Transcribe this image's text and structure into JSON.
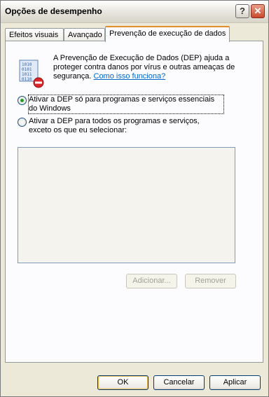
{
  "window": {
    "title": "Opções de desempenho",
    "help_glyph": "?",
    "close_glyph": "✕"
  },
  "tabs": [
    {
      "label": "Efeitos visuais"
    },
    {
      "label": "Avançado"
    },
    {
      "label": "Prevenção de execução de dados",
      "active": true
    }
  ],
  "dep": {
    "description": "A Prevenção de Execução de Dados (DEP) ajuda a proteger contra danos por vírus e outras ameaças de segurança.",
    "link": "Como isso funciona?"
  },
  "options": [
    {
      "label": "Ativar a DEP só para programas e serviços essenciais do Windows",
      "checked": true
    },
    {
      "label": "Ativar a DEP para todos os programas e serviços, exceto os que eu selecionar:",
      "checked": false
    }
  ],
  "list_buttons": {
    "add": "Adicionar...",
    "remove": "Remover"
  },
  "dialog_buttons": {
    "ok": "OK",
    "cancel": "Cancelar",
    "apply": "Aplicar"
  }
}
